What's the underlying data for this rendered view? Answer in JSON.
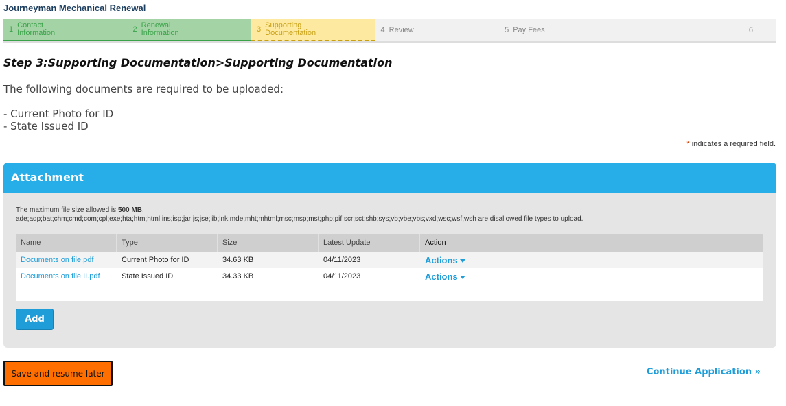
{
  "app_title": "Journeyman Mechanical Renewal",
  "steps": [
    {
      "num": "1",
      "label": "Contact Information"
    },
    {
      "num": "2",
      "label": "Renewal Information"
    },
    {
      "num": "3",
      "label": "Supporting Documentation"
    },
    {
      "num": "4",
      "label": "Review"
    },
    {
      "num": "5",
      "label": "Pay Fees"
    },
    {
      "num": "6",
      "label": ""
    }
  ],
  "step_heading": "Step 3:Supporting Documentation>Supporting Documentation",
  "instructions": "The following documents are required to be uploaded:",
  "required_docs": [
    "- Current Photo for ID",
    "- State Issued ID"
  ],
  "required_note": {
    "star": "*",
    "text": "indicates a required field."
  },
  "attachment": {
    "title": "Attachment",
    "max_size_prefix": "The maximum file size allowed is ",
    "max_size_value": "500 MB",
    "max_size_suffix": ".",
    "disallowed_types": "ade;adp;bat;chm;cmd;com;cpl;exe;hta;htm;html;ins;isp;jar;js;jse;lib;lnk;mde;mht;mhtml;msc;msp;mst;php;pif;scr;sct;shb;sys;vb;vbe;vbs;vxd;wsc;wsf;wsh",
    "disallowed_suffix": " are disallowed file types to upload.",
    "columns": [
      "Name",
      "Type",
      "Size",
      "Latest Update",
      "Action"
    ],
    "rows": [
      {
        "name": "Documents on file.pdf",
        "type": "Current Photo for ID",
        "size": "34.63 KB",
        "updated": "04/11/2023",
        "action": "Actions"
      },
      {
        "name": "Documents on file II.pdf",
        "type": "State Issued ID",
        "size": "34.33 KB",
        "updated": "04/11/2023",
        "action": "Actions"
      }
    ],
    "add_label": "Add"
  },
  "save_label": "Save and resume later",
  "continue_label": "Continue Application »"
}
